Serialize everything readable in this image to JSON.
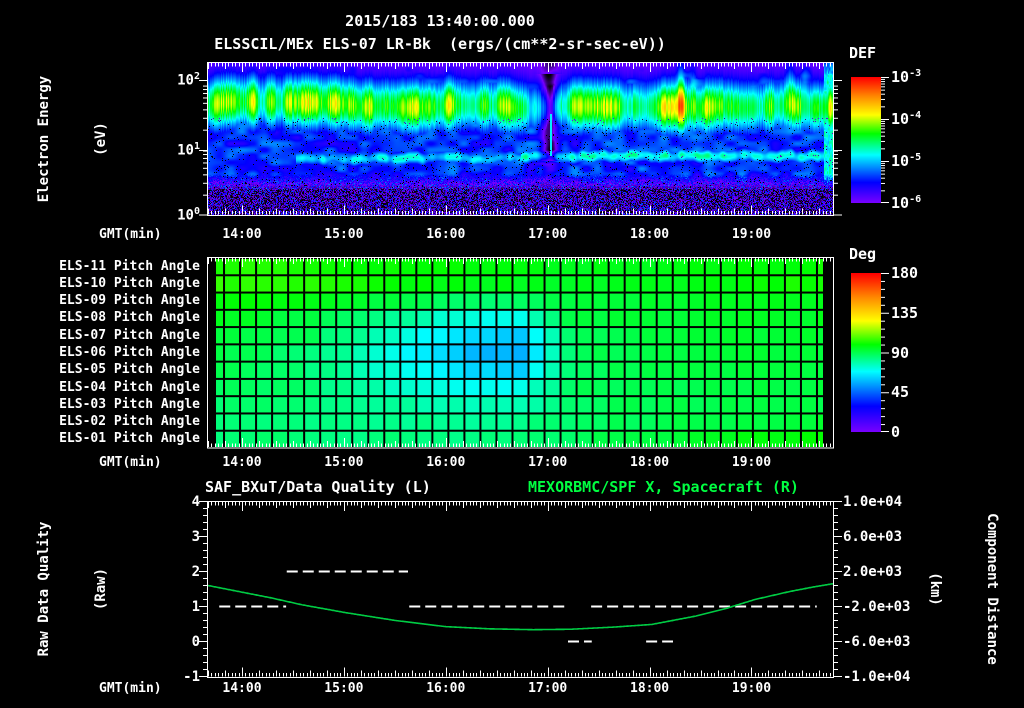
{
  "header": {
    "line1": "2015/183 13:40:00.000",
    "line2": "ELSSCIL/MEx ELS-07 LR-Bk  (ergs/(cm**2-sr-sec-eV))"
  },
  "time_axis": {
    "label": "GMT(min)",
    "hour_labels": [
      "14:00",
      "15:00",
      "16:00",
      "17:00",
      "18:00",
      "19:00"
    ],
    "start_gmt": "13:40",
    "end_gmt": "19:48"
  },
  "spectrogram_panel": {
    "ylabel_line1": "Electron Energy",
    "ylabel_line2": "(eV)",
    "yticks": [
      {
        "base": "10",
        "exp": "2"
      },
      {
        "base": "10",
        "exp": "1"
      },
      {
        "base": "10",
        "exp": "0"
      }
    ],
    "colorbar": {
      "title": "DEF",
      "ticks": [
        {
          "base": "10",
          "exp": "-3"
        },
        {
          "base": "10",
          "exp": "-4"
        },
        {
          "base": "10",
          "exp": "-5"
        },
        {
          "base": "10",
          "exp": "-6"
        }
      ]
    }
  },
  "pitch_panel": {
    "row_labels": [
      "ELS-11 Pitch Angle",
      "ELS-10 Pitch Angle",
      "ELS-09 Pitch Angle",
      "ELS-08 Pitch Angle",
      "ELS-07 Pitch Angle",
      "ELS-06 Pitch Angle",
      "ELS-05 Pitch Angle",
      "ELS-04 Pitch Angle",
      "ELS-03 Pitch Angle",
      "ELS-02 Pitch Angle",
      "ELS-01 Pitch Angle"
    ],
    "colorbar": {
      "title": "Deg",
      "tick_labels": [
        "180",
        "135",
        "90",
        "45",
        "0"
      ]
    }
  },
  "bottom_panel": {
    "left_title": "SAF_BXuT/Data Quality (L)",
    "right_title": "MEXORBMC/SPF X, Spacecraft (R)",
    "left_axis": {
      "label_line1": "Raw Data Quality",
      "label_line2": "(Raw)",
      "tick_labels": [
        "4",
        "3",
        "2",
        "1",
        "0",
        "-1"
      ]
    },
    "right_axis": {
      "label_line1": "Component Distance",
      "label_line2": "(km)",
      "tick_labels": [
        "1.0e+04",
        "6.0e+03",
        "2.0e+03",
        "-2.0e+03",
        "-6.0e+03",
        "-1.0e+04"
      ]
    }
  },
  "colors": {
    "background": "#000000",
    "text": "#ffffff",
    "title_green": "#00ff41",
    "curve_green": "#00cc44",
    "quality_white": "#ffffff",
    "colormap_stops": [
      {
        "p": 0.0,
        "color": "#7700ff"
      },
      {
        "p": 0.16,
        "color": "#0000ff"
      },
      {
        "p": 0.38,
        "color": "#00ffff"
      },
      {
        "p": 0.55,
        "color": "#00ff00"
      },
      {
        "p": 0.7,
        "color": "#ffff00"
      },
      {
        "p": 0.85,
        "color": "#ff8800"
      },
      {
        "p": 1.0,
        "color": "#ff0000"
      }
    ]
  },
  "chart_data": [
    {
      "type": "heatmap",
      "name": "electron-energy-spectrogram",
      "title": "ELSSCIL/MEx ELS-07 LR-Bk",
      "z_units": "ergs/(cm**2-sr-sec-eV)",
      "x_range_gmt": [
        "13:40",
        "19:48"
      ],
      "x_ticks": [
        "14:00",
        "15:00",
        "16:00",
        "17:00",
        "18:00",
        "19:00"
      ],
      "y_scale": "log",
      "y_range_eV": [
        1,
        185
      ],
      "y_ticks_eV": [
        100,
        10,
        1
      ],
      "z_range": [
        1e-06,
        0.001
      ],
      "bands": [
        {
          "name": "main-electron-band",
          "energy_range_eV": [
            20,
            100
          ],
          "peak_energy_eV": 43,
          "peak_def": 0.0001
        },
        {
          "name": "low-energy-line",
          "energy_range_eV": [
            6,
            9
          ],
          "peak_def": 1.6e-05,
          "from_t_frac": 0.14
        },
        {
          "name": "background",
          "def": 4e-06
        },
        {
          "name": "sub-2eV-dark",
          "def": 1e-06
        }
      ],
      "band_intensity_profile": {
        "t_frac": [
          0,
          0.04,
          0.08,
          0.11,
          0.14,
          0.2,
          0.27,
          0.33,
          0.4,
          0.45,
          0.5,
          0.535,
          0.55,
          0.565,
          0.6,
          0.65,
          0.7,
          0.75,
          0.78,
          0.82,
          0.87,
          0.9,
          0.93,
          0.955,
          0.97,
          0.985,
          1
        ],
        "amp": [
          1.62,
          1.66,
          1.5,
          1.42,
          1.5,
          1.55,
          1.5,
          1.6,
          1.55,
          1.45,
          1.4,
          1.0,
          0.85,
          1.25,
          1.3,
          1.4,
          1.45,
          1.62,
          1.58,
          1.52,
          1.5,
          1.42,
          1.35,
          1.3,
          1.4,
          1.5,
          1.55
        ]
      },
      "band_center_profile": {
        "t_frac": [
          0,
          0.3,
          0.5,
          0.7,
          1
        ],
        "log10_eV": [
          1.66,
          1.63,
          1.6,
          1.62,
          1.6
        ]
      },
      "upper_spikes": {
        "t_frac": [
          0.757,
          0.776,
          0.932,
          0.955
        ],
        "amp": [
          0.55,
          0.35,
          0.4,
          0.3
        ]
      },
      "events": [
        {
          "name": "dropout-funnel",
          "t_frac": 0.547,
          "gmt": "16:57"
        },
        {
          "name": "bright-enhancement",
          "t_frac": [
            0.7,
            0.82
          ],
          "gmt": [
            "17:58",
            "18:42"
          ]
        },
        {
          "name": "right-edge-burst",
          "t_frac": 0.99,
          "gmt": "19:44"
        }
      ]
    },
    {
      "type": "heatmap",
      "name": "pitch-angle-panel",
      "rows": [
        "ELS-11 Pitch Angle",
        "ELS-10 Pitch Angle",
        "ELS-09 Pitch Angle",
        "ELS-08 Pitch Angle",
        "ELS-07 Pitch Angle",
        "ELS-06 Pitch Angle",
        "ELS-05 Pitch Angle",
        "ELS-04 Pitch Angle",
        "ELS-03 Pitch Angle",
        "ELS-02 Pitch Angle",
        "ELS-01 Pitch Angle"
      ],
      "z_units": "deg",
      "z_range": [
        0,
        180
      ],
      "n_time_columns": 39,
      "t_frac_bins": [
        0,
        0.083,
        0.167,
        0.25,
        0.333,
        0.417,
        0.5,
        0.583,
        0.667,
        0.75,
        0.833,
        0.917,
        1
      ],
      "values_deg": [
        [
          103,
          102,
          101,
          100,
          99,
          98,
          97,
          96,
          96,
          97,
          98,
          99,
          101
        ],
        [
          104,
          103,
          102,
          100,
          98,
          97,
          96,
          95,
          96,
          97,
          98,
          100,
          102
        ],
        [
          99,
          98,
          96,
          93,
          90,
          87,
          86,
          92,
          93,
          94,
          95,
          96,
          97
        ],
        [
          96,
          94,
          91,
          85,
          78,
          72,
          70,
          91,
          92,
          93,
          94,
          95,
          95
        ],
        [
          93,
          91,
          88,
          80,
          70,
          62,
          60,
          89,
          91,
          92,
          93,
          93,
          94
        ],
        [
          91,
          89,
          85,
          77,
          67,
          58,
          57,
          88,
          90,
          91,
          92,
          93,
          93
        ],
        [
          89,
          88,
          84,
          77,
          69,
          62,
          61,
          88,
          90,
          91,
          92,
          92,
          93
        ],
        [
          88,
          87,
          85,
          79,
          74,
          70,
          70,
          88,
          89,
          90,
          91,
          91,
          92
        ],
        [
          86,
          86,
          84,
          82,
          79,
          77,
          77,
          87,
          89,
          90,
          90,
          91,
          91
        ],
        [
          85,
          85,
          84,
          83,
          82,
          81,
          82,
          87,
          89,
          90,
          91,
          92,
          93
        ],
        [
          85,
          85,
          85,
          84,
          84,
          83,
          84,
          88,
          90,
          92,
          95,
          98,
          101
        ]
      ]
    },
    {
      "type": "line",
      "name": "quality-and-spacecraft-distance",
      "x_range_gmt": [
        "13:40",
        "19:48"
      ],
      "left_axis": {
        "label": "Raw Data Quality (Raw)",
        "ylim": [
          -1,
          4
        ]
      },
      "right_axis": {
        "label": "Component Distance (km)",
        "ylim": [
          -10000,
          10000
        ]
      },
      "series": [
        {
          "name": "SAF_BXuT/Data Quality",
          "axis": "left",
          "style": "dashed",
          "color": "#ffffff",
          "segments": [
            {
              "value": 1,
              "x_frac": [
                0.018,
                0.125
              ],
              "gmt": [
                "13:47",
                "14:26"
              ]
            },
            {
              "value": 2,
              "x_frac": [
                0.126,
                0.32
              ],
              "gmt": [
                "14:26",
                "15:38"
              ]
            },
            {
              "value": 1,
              "x_frac": [
                0.322,
                0.574
              ],
              "gmt": [
                "15:38",
                "17:11"
              ]
            },
            {
              "value": 0,
              "x_frac": [
                0.576,
                0.614
              ],
              "gmt": [
                "17:12",
                "17:26"
              ]
            },
            {
              "value": 1,
              "x_frac": [
                0.613,
                0.974
              ],
              "gmt": [
                "17:26",
                "19:38"
              ]
            },
            {
              "value": 0,
              "x_frac": [
                0.701,
                0.744
              ],
              "gmt": [
                "17:58",
                "18:14"
              ]
            }
          ]
        },
        {
          "name": "MEXORBMC/SPF X, Spacecraft",
          "axis": "right",
          "style": "solid",
          "color": "#00cc44",
          "points": [
            [
              0,
              400
            ],
            [
              0.05,
              -300
            ],
            [
              0.1,
              -1000
            ],
            [
              0.15,
              -1800
            ],
            [
              0.22,
              -2700
            ],
            [
              0.3,
              -3600
            ],
            [
              0.38,
              -4300
            ],
            [
              0.45,
              -4550
            ],
            [
              0.52,
              -4650
            ],
            [
              0.58,
              -4600
            ],
            [
              0.65,
              -4350
            ],
            [
              0.71,
              -4050
            ],
            [
              0.78,
              -3100
            ],
            [
              0.83,
              -2200
            ],
            [
              0.875,
              -1200
            ],
            [
              0.93,
              -300
            ],
            [
              0.97,
              250
            ],
            [
              1,
              600
            ]
          ]
        }
      ]
    }
  ]
}
